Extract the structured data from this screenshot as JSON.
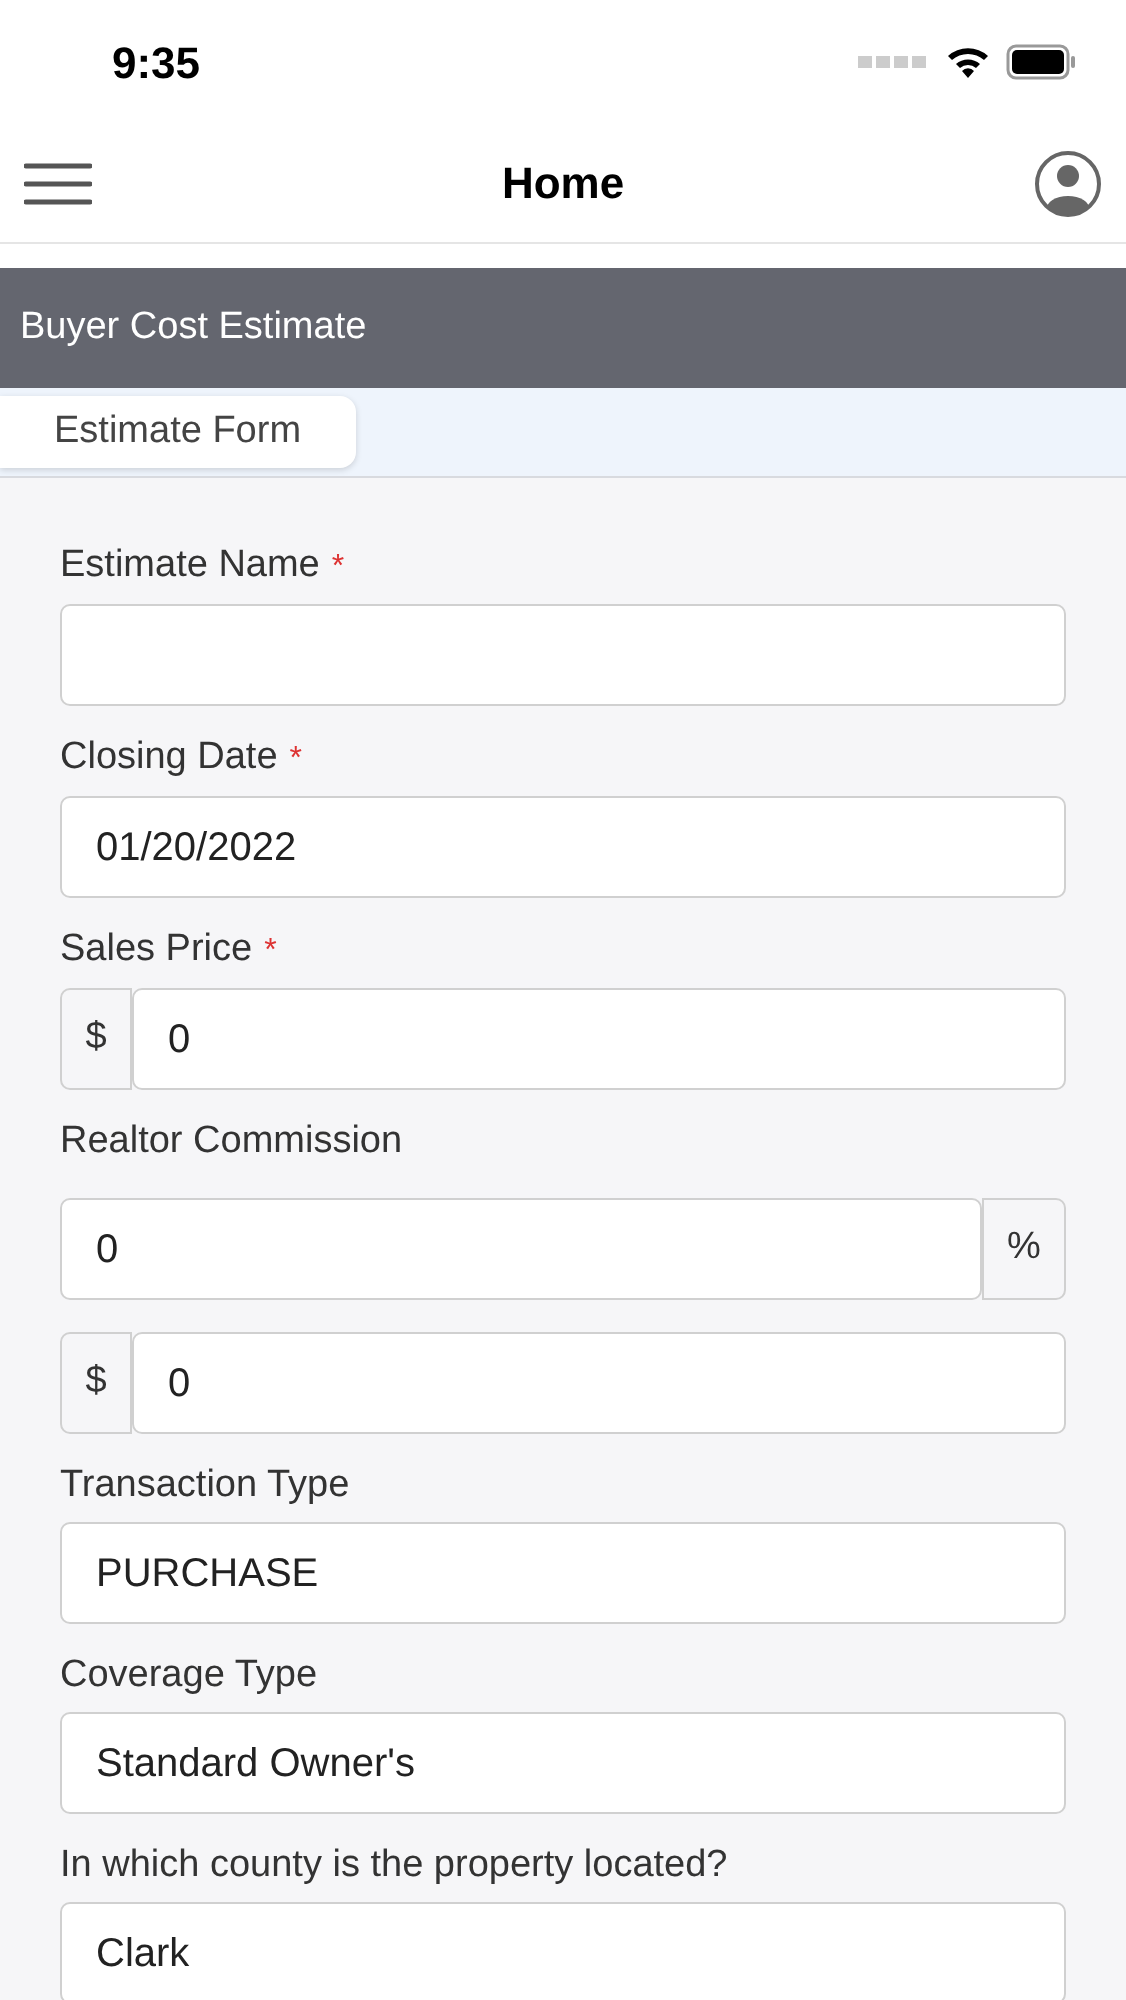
{
  "status_bar": {
    "time": "9:35"
  },
  "nav": {
    "title": "Home"
  },
  "section": {
    "title": "Buyer Cost Estimate"
  },
  "tabs": [
    {
      "label": "Estimate Form",
      "selected": true
    }
  ],
  "fields": [
    {
      "label": "Estimate Name",
      "marker": "*",
      "inputs": [
        {
          "kind": "plain"
        }
      ]
    },
    {
      "label": "Closing Date",
      "marker": "*",
      "inputs": [
        {
          "kind": "plain",
          "value": "01/20/2022"
        }
      ]
    },
    {
      "label": "Sales Price",
      "marker": "*",
      "inputs": [
        {
          "kind": "prefix",
          "addon": "$",
          "value": "0"
        }
      ]
    },
    {
      "label": "Realtor Commission",
      "inputs": [
        {
          "kind": "suffix",
          "value": "0",
          "addon": "%"
        },
        {
          "kind": "prefix",
          "addon": "$",
          "value": "0"
        }
      ]
    },
    {
      "label": "Transaction Type",
      "inputs": [
        {
          "kind": "plain",
          "value": "PURCHASE"
        }
      ]
    },
    {
      "label": "Coverage Type",
      "inputs": [
        {
          "kind": "plain",
          "value": "Standard Owner's"
        }
      ]
    },
    {
      "label": "In which county is the property located?",
      "inputs": [
        {
          "kind": "plain",
          "value": "Clark"
        }
      ]
    }
  ]
}
